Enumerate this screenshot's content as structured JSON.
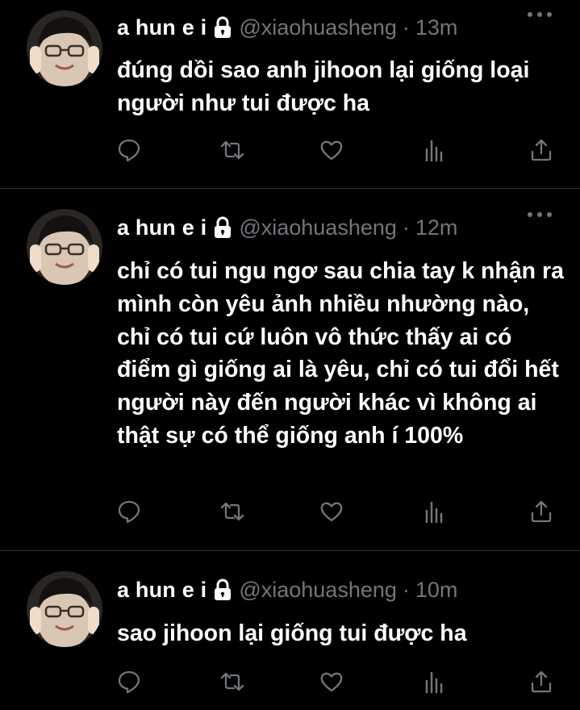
{
  "tweets": [
    {
      "name": "a hun e i",
      "handle": "@xiaohuasheng",
      "separator": "·",
      "time": "13m",
      "text": "đúng dồi sao anh jihoon lại giống loại người như tui được ha"
    },
    {
      "name": "a hun e i",
      "handle": "@xiaohuasheng",
      "separator": "·",
      "time": "12m",
      "text": "chỉ có tui ngu ngơ sau chia tay k nhận ra mình còn yêu ảnh nhiều nhường nào, chỉ có tui cứ luôn vô thức thấy ai có điểm gì giống ai là yêu, chỉ có tui đổi hết người này đến người khác vì không ai thật sự có thể giống anh í 100%"
    },
    {
      "name": "a hun e i",
      "handle": "@xiaohuasheng",
      "separator": "·",
      "time": "10m",
      "text": "sao jihoon lại giống tui được ha"
    }
  ],
  "icons": {
    "avatar": "avatar-photo",
    "lock": "lock-icon",
    "more": "more-icon",
    "reply": "reply-icon",
    "retweet": "retweet-icon",
    "like": "like-icon",
    "analytics": "analytics-icon",
    "share": "share-icon"
  },
  "colors": {
    "background": "#000000",
    "text": "#ffffff",
    "secondary": "#71767b",
    "divider": "#2f3336"
  }
}
